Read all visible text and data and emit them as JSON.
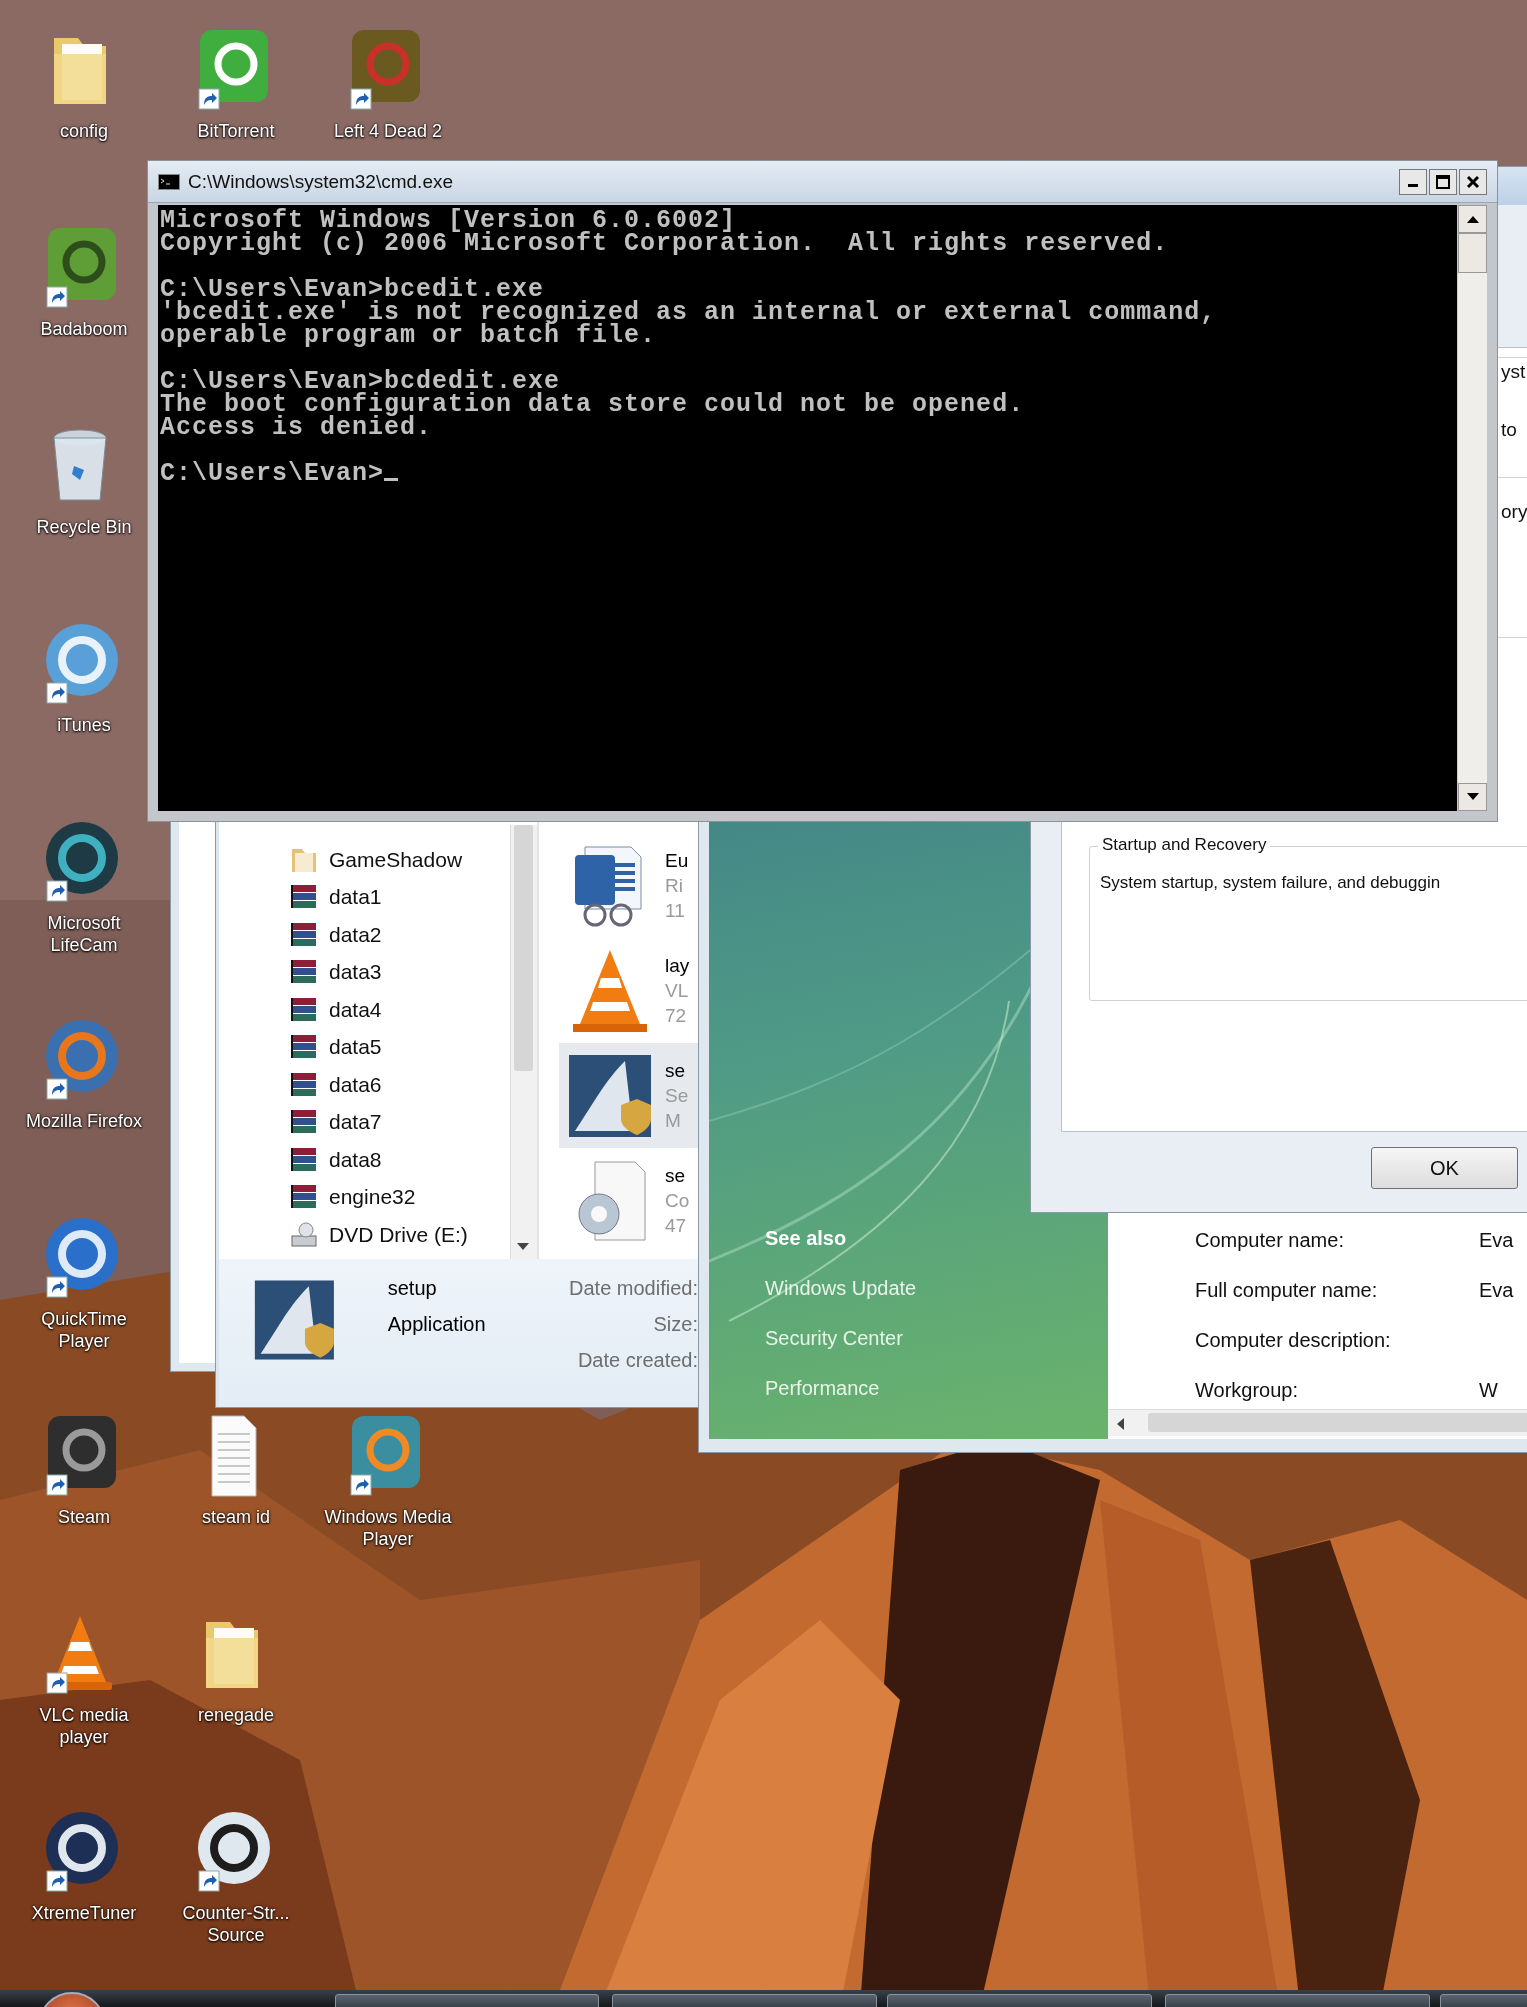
{
  "desktop_icons": [
    {
      "label": "config",
      "kind": "folder",
      "shortcut": false
    },
    {
      "label": "BitTorrent",
      "kind": "app",
      "shortcut": true
    },
    {
      "label": "Left 4 Dead 2",
      "kind": "app",
      "shortcut": true
    },
    {
      "label": "Badaboom",
      "kind": "app",
      "shortcut": true
    },
    {
      "label": "Recycle Bin",
      "kind": "bin",
      "shortcut": false
    },
    {
      "label": "iTunes",
      "kind": "app",
      "shortcut": true
    },
    {
      "label": "Microsoft LifeCam",
      "kind": "app",
      "shortcut": true
    },
    {
      "label": "Mozilla Firefox",
      "kind": "app",
      "shortcut": true
    },
    {
      "label": "QuickTime Player",
      "kind": "app",
      "shortcut": true
    },
    {
      "label": "Steam",
      "kind": "app",
      "shortcut": true
    },
    {
      "label": "steam id",
      "kind": "document",
      "shortcut": false
    },
    {
      "label": "Windows Media Player",
      "kind": "app",
      "shortcut": true
    },
    {
      "label": "VLC media player",
      "kind": "app",
      "shortcut": true
    },
    {
      "label": "renegade",
      "kind": "folder",
      "shortcut": false
    },
    {
      "label": "XtremeTuner",
      "kind": "app",
      "shortcut": true
    },
    {
      "label": "Counter-Str... Source",
      "kind": "app",
      "shortcut": true
    }
  ],
  "explorer": {
    "tree": [
      {
        "label": "GameShadow",
        "kind": "folder"
      },
      {
        "label": "data1",
        "kind": "archive"
      },
      {
        "label": "data2",
        "kind": "archive"
      },
      {
        "label": "data3",
        "kind": "archive"
      },
      {
        "label": "data4",
        "kind": "archive"
      },
      {
        "label": "data5",
        "kind": "archive"
      },
      {
        "label": "data6",
        "kind": "archive"
      },
      {
        "label": "data7",
        "kind": "archive"
      },
      {
        "label": "data8",
        "kind": "archive"
      },
      {
        "label": "engine32",
        "kind": "archive"
      },
      {
        "label": "DVD Drive (E:)",
        "kind": "drive"
      }
    ],
    "files": [
      {
        "kind": "document",
        "selected": false,
        "lines": [
          "Eu",
          "Ri",
          "11"
        ]
      },
      {
        "kind": "media",
        "selected": false,
        "lines": [
          "lay",
          "VL",
          "72"
        ]
      },
      {
        "kind": "setup",
        "selected": true,
        "lines": [
          "se",
          "Se",
          "M"
        ]
      },
      {
        "kind": "config",
        "selected": false,
        "lines": [
          "se",
          "Co",
          "47"
        ]
      }
    ],
    "details": {
      "name": "setup",
      "type": "Application",
      "fields": [
        "Date modified:",
        "Size:",
        "Date created:"
      ]
    }
  },
  "system": {
    "see_also_title": "See also",
    "see_also": [
      "Windows Update",
      "Security Center",
      "Performance"
    ],
    "computer": [
      {
        "label": "Computer name:",
        "value": "Eva"
      },
      {
        "label": "Full computer name:",
        "value": "Eva"
      },
      {
        "label": "Computer description:"
      },
      {
        "label": "Workgroup:",
        "value": "W"
      }
    ]
  },
  "dialog": {
    "fragments": [
      "yst",
      "to",
      "ory"
    ],
    "group_title": "Startup and Recovery",
    "group_text": "System startup, system failure, and debuggin",
    "button": "OK"
  },
  "cmd": {
    "title": "C:\\Windows\\system32\\cmd.exe",
    "paragraphs": [
      [
        "Microsoft Windows [Version 6.0.6002]",
        "Copyright (c) 2006 Microsoft Corporation.  All rights reserved."
      ],
      [
        "C:\\Users\\Evan>bcedit.exe",
        "'bcedit.exe' is not recognized as an internal or external command,",
        "operable program or batch file."
      ],
      [
        "C:\\Users\\Evan>bcdedit.exe",
        "The boot configuration data store could not be opened.",
        "Access is denied."
      ],
      [
        "C:\\Users\\Evan>"
      ]
    ]
  }
}
